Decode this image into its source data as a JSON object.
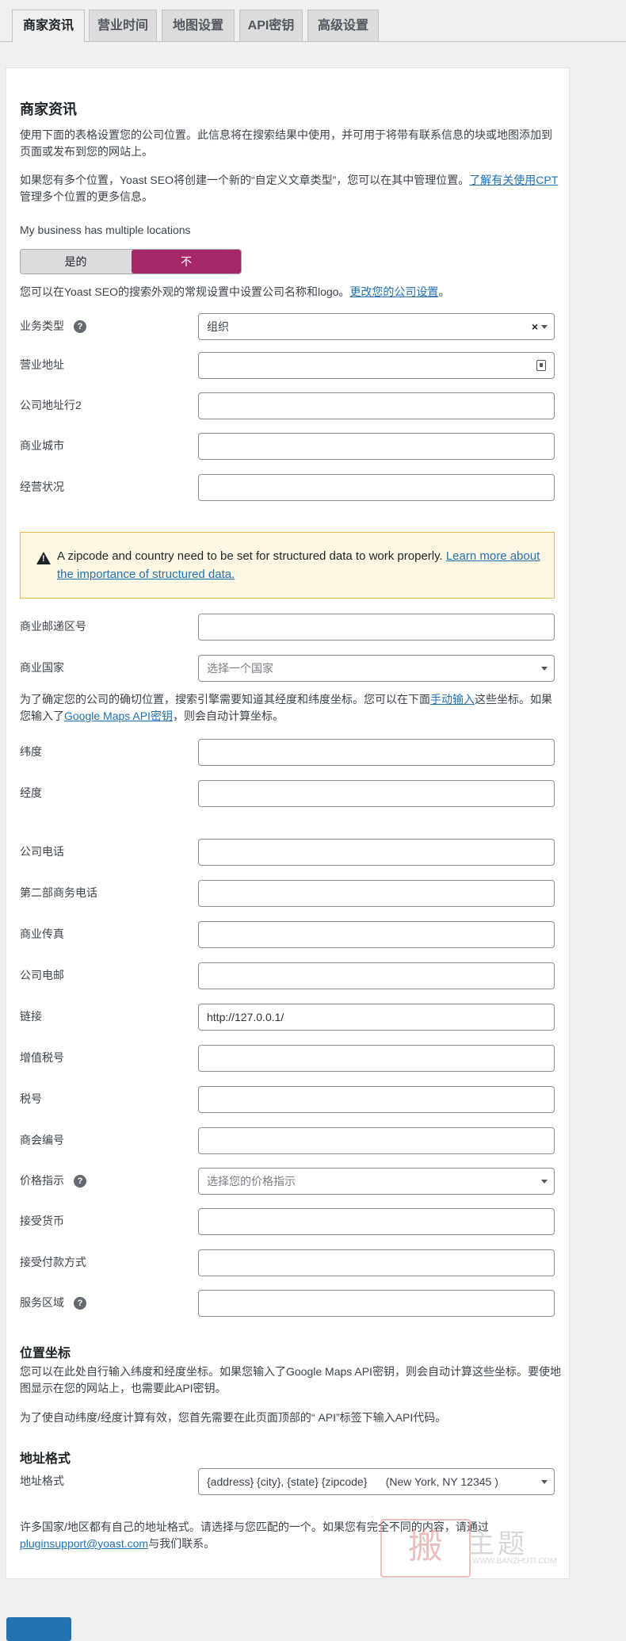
{
  "tabs": [
    {
      "label": "商家资讯",
      "active": true
    },
    {
      "label": "营业时间",
      "active": false
    },
    {
      "label": "地图设置",
      "active": false
    },
    {
      "label": "API密钥",
      "active": false
    },
    {
      "label": "高级设置",
      "active": false
    }
  ],
  "section": {
    "title": "商家资讯",
    "intro": "使用下面的表格设置您的公司位置。此信息将在搜索结果中使用，并可用于将带有联系信息的块或地图添加到页面或发布到您的网站上。",
    "multi_pre": "如果您有多个位置，Yoast SEO将创建一个新的“自定义文章类型”，您可以在其中管理位置。",
    "multi_link": "了解有关使用CPT",
    "multi_post": "管理多个位置的更多信息。",
    "multi_locations_label": "My business has multiple locations",
    "toggle_yes": "是的",
    "toggle_no": "不",
    "appearance_pre": "您可以在Yoast SEO的搜索外观的常规设置中设置公司名称和logo。",
    "appearance_link": "更改您的公司设置",
    "appearance_post": "。"
  },
  "fields": {
    "business_type": {
      "label": "业务类型",
      "value": "组织",
      "clear": "×"
    },
    "address": {
      "label": "营业地址",
      "value": ""
    },
    "address2": {
      "label": "公司地址行2",
      "value": ""
    },
    "city": {
      "label": "商业城市",
      "value": ""
    },
    "state": {
      "label": "经营状况",
      "value": ""
    },
    "zipcode": {
      "label": "商业邮递区号",
      "value": ""
    },
    "country": {
      "label": "商业国家",
      "placeholder": "选择一个国家"
    },
    "latitude": {
      "label": "纬度",
      "value": ""
    },
    "longitude": {
      "label": "经度",
      "value": ""
    },
    "phone": {
      "label": "公司电话",
      "value": ""
    },
    "phone2": {
      "label": "第二部商务电话",
      "value": ""
    },
    "fax": {
      "label": "商业传真",
      "value": ""
    },
    "email": {
      "label": "公司电邮",
      "value": ""
    },
    "url": {
      "label": "链接",
      "value": "http://127.0.0.1/"
    },
    "vat": {
      "label": "增值税号",
      "value": ""
    },
    "tax": {
      "label": "税号",
      "value": ""
    },
    "coc": {
      "label": "商会编号",
      "value": ""
    },
    "price_range": {
      "label": "价格指示",
      "placeholder": "选择您的价格指示"
    },
    "currencies": {
      "label": "接受货币",
      "value": ""
    },
    "payment": {
      "label": "接受付款方式",
      "value": ""
    },
    "area_served": {
      "label": "服务区域",
      "value": ""
    }
  },
  "help_icon": "?",
  "warning": {
    "text": "A zipcode and country need to be set for structured data to work properly.",
    "link": "Learn more about the importance of structured data."
  },
  "coords_note": {
    "pre": "为了确定您的公司的确切位置，搜索引擎需要知道其经度和纬度坐标。您可以在下面",
    "link1": "手动输入",
    "mid": "这些坐标。如果您输入了",
    "link2": "Google Maps API密钥",
    "post": "，则会自动计算坐标。"
  },
  "location_coords": {
    "title": "位置坐标",
    "p1": "您可以在此处自行输入纬度和经度坐标。如果您输入了Google Maps API密钥，则会自动计算这些坐标。要使地图显示在您的网站上，也需要此API密钥。",
    "p2": "为了使自动纬度/经度计算有效，您首先需要在此页面顶部的“ API”标签下输入API代码。"
  },
  "address_format": {
    "title": "地址格式",
    "label": "地址格式",
    "value": "{address} {city}, {state} {zipcode}      (New York, NY 12345 )",
    "note_pre": "许多国家/地区都有自己的地址格式。请选择与您匹配的一个。如果您有完全不同的内容，请通过",
    "note_link": "pluginsupport@yoast.com",
    "note_post": "与我们联系。"
  },
  "watermark": {
    "seal": "搬",
    "text": "主题",
    "url": "WWW.BANZHUTI.COM"
  },
  "colors": {
    "accent": "#a4286a",
    "link": "#2271b1",
    "warning_bg": "#fff8e5",
    "warning_border": "#f0b849"
  }
}
